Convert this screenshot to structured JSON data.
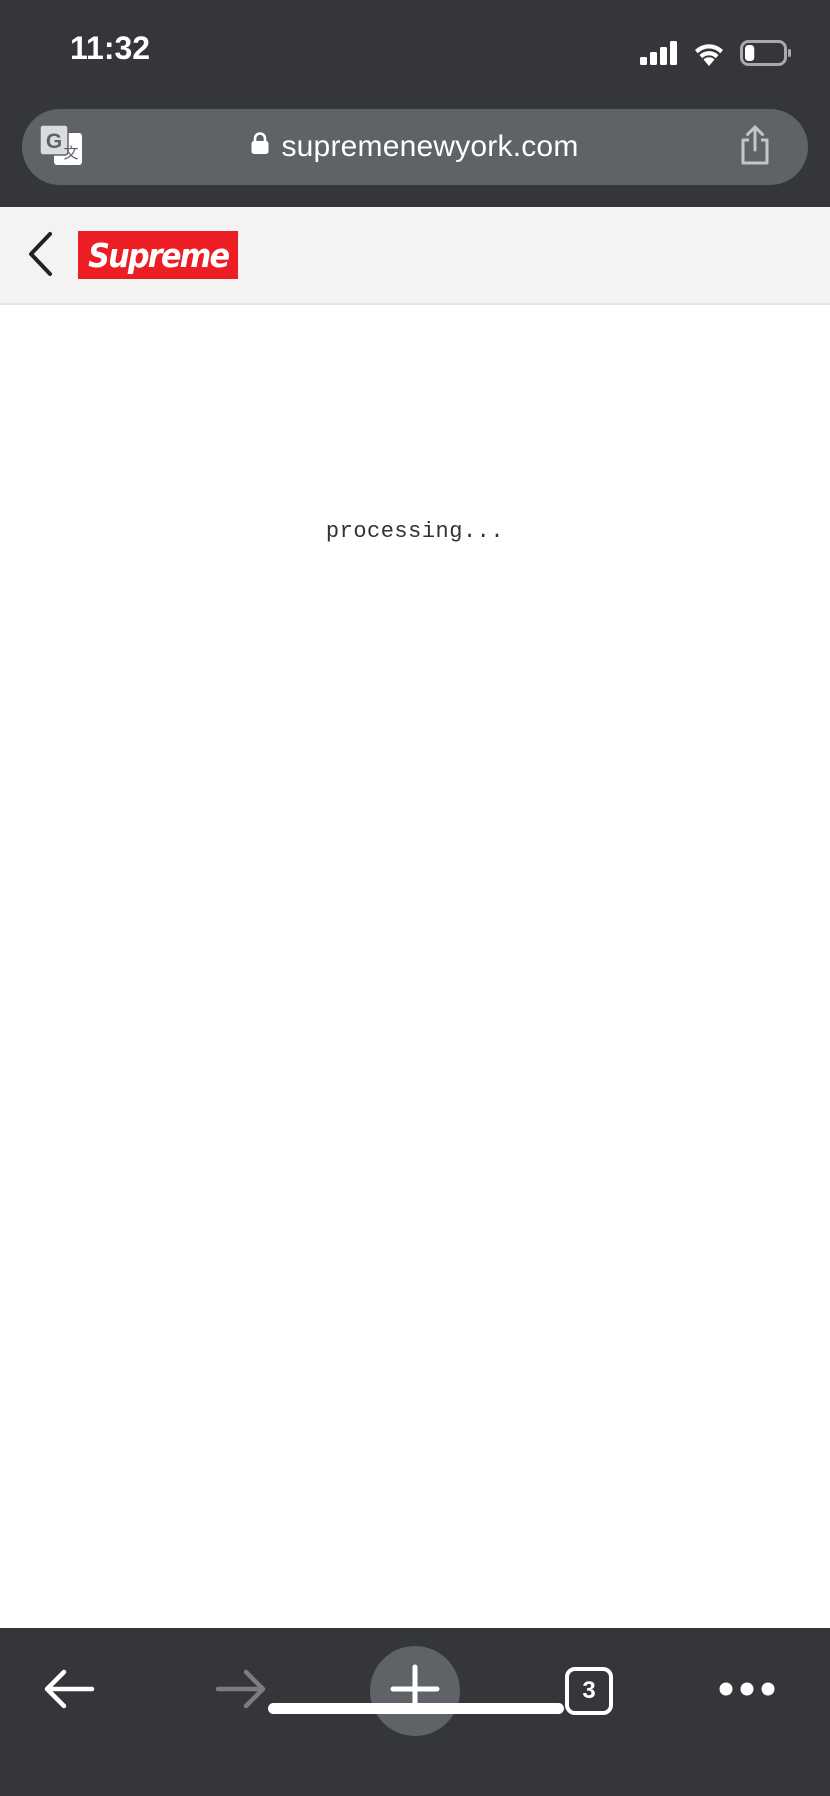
{
  "status_bar": {
    "time": "11:32",
    "icons": [
      "cellular-signal-icon",
      "wifi-icon",
      "battery-icon"
    ],
    "battery_level": 0.25
  },
  "address_bar": {
    "url": "supremenewyork.com",
    "left_icon": "translate-icon",
    "lock_icon": "lock-icon",
    "right_icon": "share-icon"
  },
  "site_header": {
    "back_icon": "chevron-left-icon",
    "logo_text": "Supreme"
  },
  "main": {
    "status_text": "processing..."
  },
  "toolbar": {
    "back_icon": "arrow-left-icon",
    "forward_icon": "arrow-right-icon",
    "new_tab_icon": "plus-icon",
    "tab_count": "3",
    "menu_icon": "more-horizontal-icon"
  },
  "colors": {
    "chrome_background": "#35363a",
    "url_bar_background": "#5f6368",
    "header_background": "#f3f3f3",
    "supreme_red": "#ec1e24",
    "disabled_icon": "#7c7d80"
  }
}
